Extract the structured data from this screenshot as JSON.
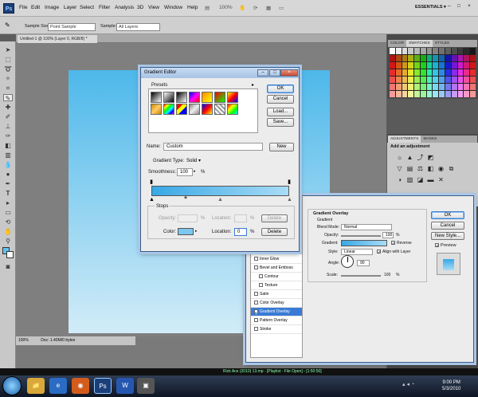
{
  "app": {
    "logo": "Ps",
    "menu": [
      "File",
      "Edit",
      "Image",
      "Layer",
      "Select",
      "Filter",
      "Analysis",
      "3D",
      "View",
      "Window",
      "Help"
    ],
    "zoom": "100%",
    "workspace": "ESSENTIALS ▾",
    "window_controls": [
      "–",
      "□",
      "×"
    ]
  },
  "options": {
    "sample_size_label": "Sample Size:",
    "sample_size_value": "Point Sample",
    "sample_label": "Sample:",
    "sample_value": "All Layers"
  },
  "document": {
    "tab": "Untitled-1 @ 100% (Layer 0, RGB/8) *",
    "status_zoom": "100%",
    "status_doc": "Doc: 1.40M/0 bytes"
  },
  "colors": {
    "gradient_start": "#38a8e6",
    "gradient_end": "#a9dcf6",
    "canvas_top": "#4db8ea",
    "canvas_bottom": "#d2ecf8"
  },
  "panels": {
    "top_tabs": [
      "COLOR",
      "SWATCHES",
      "STYLES"
    ],
    "adj_tabs": [
      "ADJUSTMENTS",
      "MASKS"
    ],
    "adj_title": "Add an adjustment"
  },
  "gradient_editor": {
    "title": "Gradient Editor",
    "presets_label": "Presets",
    "buttons": {
      "ok": "OK",
      "cancel": "Cancel",
      "load": "Load...",
      "save": "Save...",
      "new": "New",
      "delete": "Delete"
    },
    "name_label": "Name:",
    "name_value": "Custom",
    "type_label": "Gradient Type:",
    "type_value": "Solid",
    "smooth_label": "Smoothness:",
    "smooth_value": "100",
    "pct": "%",
    "stops_label": "Stops",
    "opacity_label": "Opacity:",
    "location_label": "Location:",
    "color_label": "Color:",
    "color_location_value": "0"
  },
  "layer_style": {
    "section": "Gradient Overlay",
    "sub": "Gradient",
    "blend_label": "Blend Mode:",
    "blend_value": "Normal",
    "opacity_label": "Opacity:",
    "opacity_value": "100",
    "gradient_label": "Gradient:",
    "reverse": "Reverse",
    "style_label": "Style:",
    "style_value": "Linear",
    "align": "Align with Layer",
    "angle_label": "Angle:",
    "angle_value": "90",
    "scale_label": "Scale:",
    "scale_value": "100",
    "ok": "OK",
    "cancel": "Cancel",
    "new_style": "New Style...",
    "preview": "Preview",
    "effects": [
      "Inner Glow",
      "Bevel and Emboss",
      "Contour",
      "Texture",
      "Satin",
      "Color Overlay",
      "Gradient Overlay",
      "Pattern Overlay",
      "Stroke"
    ]
  },
  "taskbar": {
    "time": "9:00 PM",
    "date": "5/3/2010",
    "media": "Rick Ace (2010) 13.mp  ·  [Playlist - File Open] - [1:50:50]"
  }
}
